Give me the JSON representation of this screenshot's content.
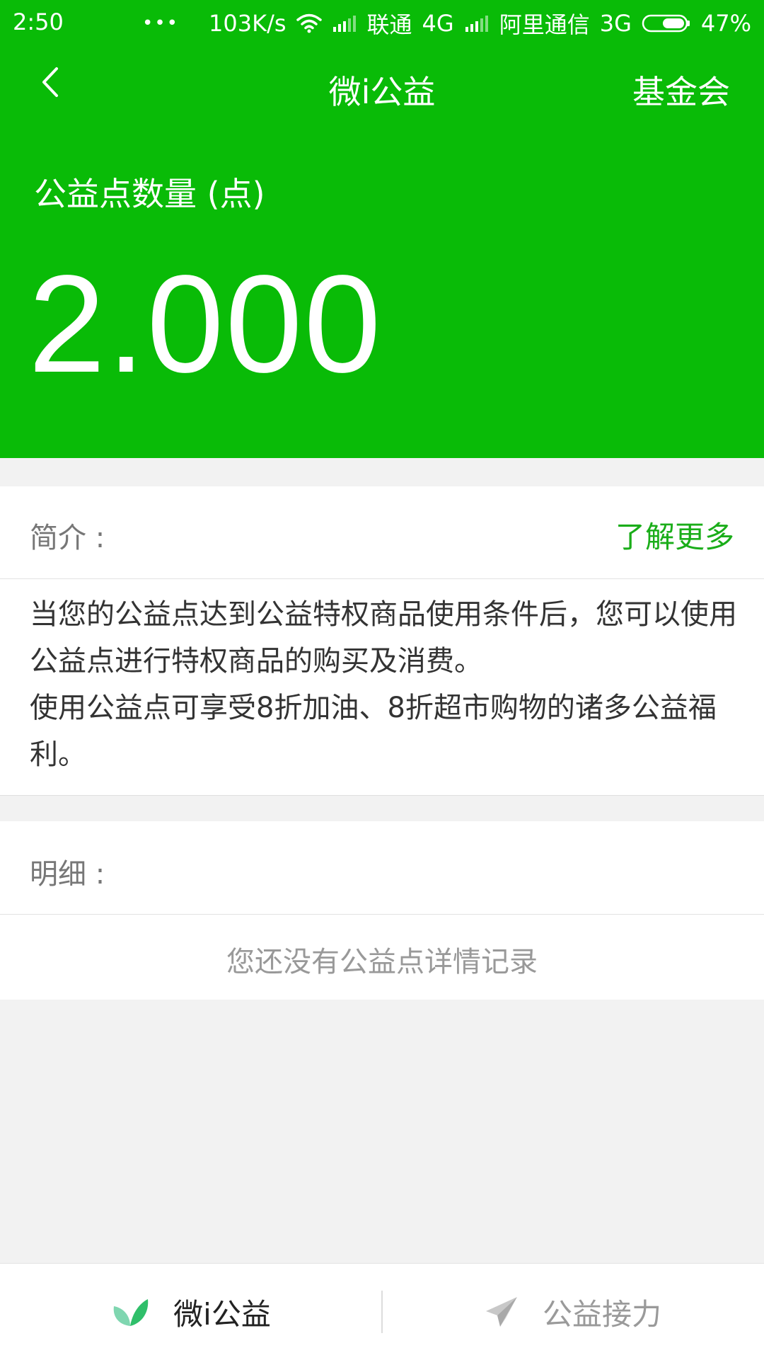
{
  "status_bar": {
    "time": "2:50",
    "dots": "•••",
    "speed": "103K/s",
    "carrier1": "联通",
    "network1": "4G",
    "carrier2": "阿里通信",
    "network2": "3G",
    "battery": "47%"
  },
  "nav": {
    "title": "微i公益",
    "right_link": "基金会"
  },
  "points": {
    "label": "公益点数量 (点)",
    "value": "2.000"
  },
  "intro": {
    "label": "简介 :",
    "learn_more": "了解更多",
    "paragraph1": "当您的公益点达到公益特权商品使用条件后，您可以使用公益点进行特权商品的购买及消费。",
    "paragraph2": "使用公益点可享受8折加油、8折超市购物的诸多公益福利。"
  },
  "details": {
    "label": "明细 :",
    "empty_message": "您还没有公益点详情记录"
  },
  "tabs": [
    {
      "label": "微i公益",
      "icon": "leaf-icon"
    },
    {
      "label": "公益接力",
      "icon": "paper-plane-icon"
    }
  ],
  "colors": {
    "brand_green": "#09bb07",
    "link_green": "#1aad19"
  }
}
